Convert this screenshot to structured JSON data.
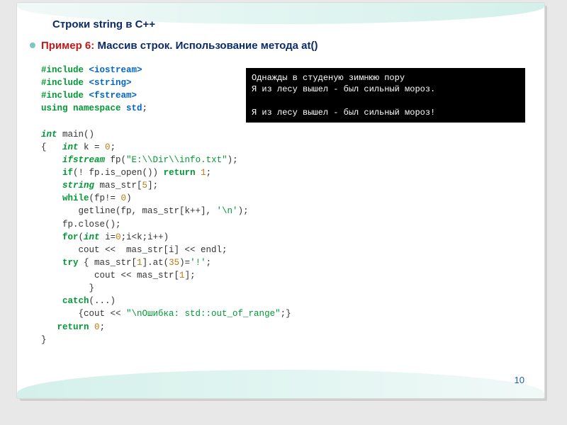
{
  "title": "Строки  string в С++",
  "subtitle": {
    "label": "Пример 6:",
    "text": " Массив строк. Использование метода at()"
  },
  "console": {
    "line1": "Однажды в студеную зимнюю пору",
    "line2": "Я из лесу вышел - был сильный мороз.",
    "line3": "",
    "line4": "Я из лесу вышел - был сильный мороз!"
  },
  "code": {
    "l1_a": "#include",
    "l1_b": " <iostream>",
    "l2_a": "#include",
    "l2_b": " <string>",
    "l3_a": "#include",
    "l3_b": " <fstream>",
    "l4_a": "using namespace",
    "l4_b": " std",
    "l4_c": ";",
    "l5": "",
    "l6_a": "int",
    "l6_b": " main()",
    "l7_a": "{   ",
    "l7_b": "int",
    "l7_c": " k = ",
    "l7_d": "0",
    "l7_e": ";",
    "l8_a": "    ",
    "l8_b": "ifstream",
    "l8_c": " fp(",
    "l8_d": "\"E:\\\\Dir\\\\info.txt\"",
    "l8_e": ");",
    "l9_a": "    ",
    "l9_b": "if",
    "l9_c": "(! fp.is_open()) ",
    "l9_d": "return",
    "l9_e": " ",
    "l9_f": "1",
    "l9_g": ";",
    "l10_a": "    ",
    "l10_b": "string",
    "l10_c": " mas_str[",
    "l10_d": "5",
    "l10_e": "];",
    "l11_a": "    ",
    "l11_b": "while",
    "l11_c": "(fp!= ",
    "l11_d": "0",
    "l11_e": ")",
    "l12_a": "       getline(fp, mas_str[k++], ",
    "l12_b": "'\\n'",
    "l12_c": ");",
    "l13": "    fp.close();",
    "l14_a": "    ",
    "l14_b": "for",
    "l14_c": "(",
    "l14_d": "int",
    "l14_e": " i=",
    "l14_f": "0",
    "l14_g": ";i<k;i++)",
    "l15_a": "       cout <<  mas_str[i] << endl;",
    "l16_a": "    ",
    "l16_b": "try",
    "l16_c": " { mas_str[",
    "l16_d": "1",
    "l16_e": "].at(",
    "l16_f": "35",
    "l16_g": ")=",
    "l16_h": "'!'",
    "l16_i": ";",
    "l17_a": "          cout << mas_str[",
    "l17_b": "1",
    "l17_c": "];",
    "l18": "         }",
    "l19_a": "    ",
    "l19_b": "catch",
    "l19_c": "(...)",
    "l20_a": "       {cout << ",
    "l20_b": "\"\\nОшибка: std::out_of_range\"",
    "l20_c": ";}",
    "l21_a": "   ",
    "l21_b": "return",
    "l21_c": " ",
    "l21_d": "0",
    "l21_e": ";",
    "l22": "}"
  },
  "page_number": "10"
}
